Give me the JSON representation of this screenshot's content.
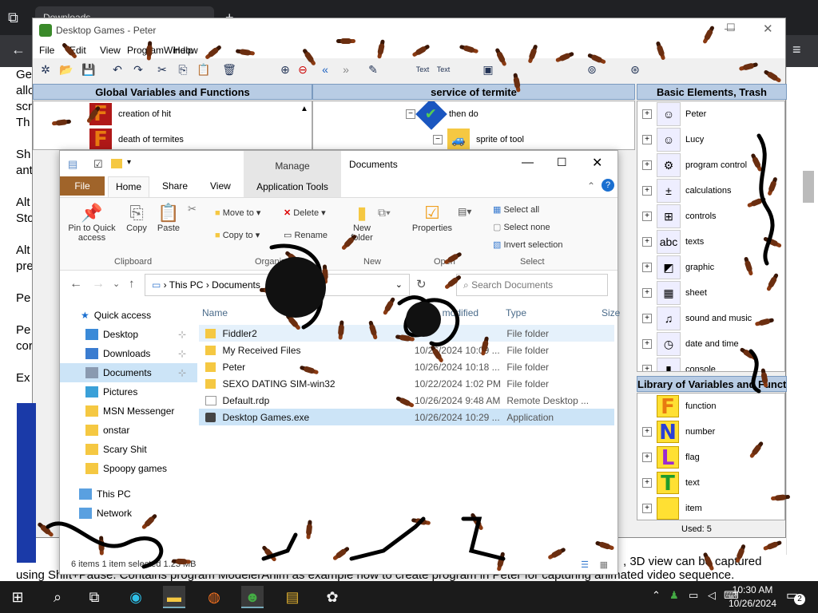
{
  "browser": {
    "tab_title": "Downloads",
    "back_icon": "arrow-left-icon",
    "menu_icon": "menu-icon"
  },
  "webpage": {
    "left_fragments": [
      "Ge",
      "allo",
      "scr",
      "Th",
      "",
      "Sh",
      "ant",
      "",
      "Alt",
      "Sto",
      "",
      "Alt",
      "pre",
      "",
      "Pe",
      "",
      "Pe",
      "cor",
      "",
      "Ex"
    ],
    "bottom_line_1": ", 3D view can be captured",
    "bottom_line_2": "using Shift+Pause. Contains program ModelerAnim as example how to create program in Peter for capturing animated video sequence."
  },
  "desktop_games": {
    "title": "Desktop Games - Peter",
    "menu": [
      "File",
      "Edit",
      "View",
      "Program",
      "Window",
      "Help"
    ],
    "panel_global": {
      "header": "Global Variables and Functions",
      "items": [
        {
          "letter": "F",
          "label": "creation of hit"
        },
        {
          "letter": "F",
          "label": "death of termites"
        }
      ]
    },
    "panel_service": {
      "header": "service of termite",
      "items": [
        {
          "label": "then do"
        },
        {
          "label": "sprite of tool"
        }
      ]
    },
    "panel_basic": {
      "header": "Basic Elements, Trash",
      "items": [
        "Peter",
        "Lucy",
        "program control",
        "calculations",
        "controls",
        "texts",
        "graphic",
        "sheet",
        "sound and music",
        "date and time",
        "console"
      ]
    },
    "panel_library": {
      "header": "Library of Variables and Functions",
      "items": [
        {
          "letter": "F",
          "label": "function",
          "color": "#e87a10"
        },
        {
          "letter": "N",
          "label": "number",
          "color": "#2a3fd6"
        },
        {
          "letter": "L",
          "label": "flag",
          "color": "#9b2bd0"
        },
        {
          "letter": "T",
          "label": "text",
          "color": "#1e9b2b"
        },
        {
          "letter": "",
          "label": "item",
          "color": "#c03030"
        }
      ],
      "status": "Used: 5"
    }
  },
  "explorer": {
    "title": "Documents",
    "context_tab": "Manage",
    "tabs": [
      "File",
      "Home",
      "Share",
      "View",
      "Application Tools"
    ],
    "ribbon": {
      "pin": "Pin to Quick access",
      "copy": "Copy",
      "paste": "Paste",
      "move_to": "Move to",
      "copy_to": "Copy to",
      "delete": "Delete",
      "rename": "Rename",
      "new_folder": "New folder",
      "properties": "Properties",
      "select_all": "Select all",
      "select_none": "Select none",
      "invert_selection": "Invert selection",
      "groups": [
        "Clipboard",
        "Organize",
        "New",
        "Open",
        "Select"
      ]
    },
    "address": {
      "crumb_1": "This PC",
      "crumb_2": "Documents",
      "search_placeholder": "Search Documents"
    },
    "nav": {
      "quick_access": "Quick access",
      "items": [
        "Desktop",
        "Downloads",
        "Documents",
        "Pictures",
        "MSN Messenger",
        "onstar",
        "Scary Shit",
        "Spoopy games"
      ],
      "this_pc": "This PC",
      "network": "Network"
    },
    "columns": {
      "name": "Name",
      "date": "Date modified",
      "type": "Type",
      "size": "Size"
    },
    "files": [
      {
        "name": "Fiddler2",
        "date": "",
        "type": "File folder",
        "kind": "folder"
      },
      {
        "name": "My Received Files",
        "date": "10/26/2024 10:09 ...",
        "type": "File folder",
        "kind": "folder"
      },
      {
        "name": "Peter",
        "date": "10/26/2024 10:18 ...",
        "type": "File folder",
        "kind": "folder"
      },
      {
        "name": "SEXO DATING SIM-win32",
        "date": "10/22/2024 1:02 PM",
        "type": "File folder",
        "kind": "folder"
      },
      {
        "name": "Default.rdp",
        "date": "10/26/2024 9:48 AM",
        "type": "Remote Desktop ...",
        "kind": "rdp"
      },
      {
        "name": "Desktop Games.exe",
        "date": "10/26/2024 10:29 ...",
        "type": "Application",
        "kind": "exe"
      }
    ],
    "status": "6 items    1 item selected  1.23 MB"
  },
  "taskbar": {
    "time": "10:30 AM",
    "date": "10/26/2024",
    "notifications": "2"
  }
}
